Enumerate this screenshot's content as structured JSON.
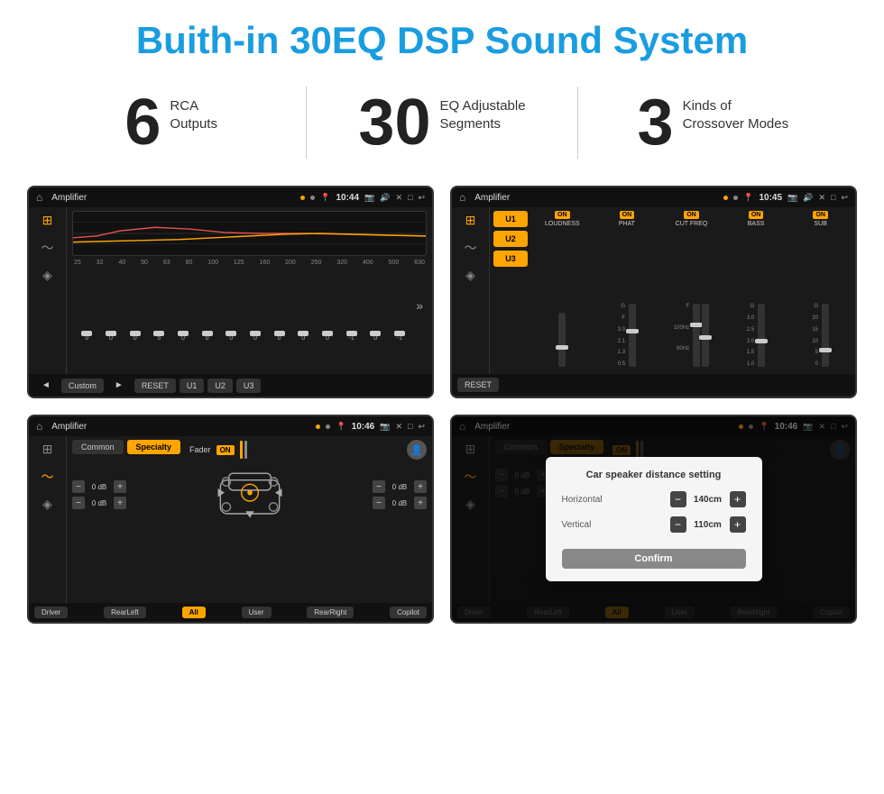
{
  "page": {
    "title": "Buith-in 30EQ DSP Sound System"
  },
  "stats": [
    {
      "number": "6",
      "label": "RCA\nOutputs"
    },
    {
      "number": "30",
      "label": "EQ Adjustable\nSegments"
    },
    {
      "number": "3",
      "label": "Kinds of\nCrossover Modes"
    }
  ],
  "screens": {
    "eq_screen": {
      "status": {
        "title": "Amplifier",
        "time": "10:44",
        "icons": [
          "▶",
          "⊕",
          "📷",
          "🔊",
          "✕",
          "□"
        ]
      },
      "freq_labels": [
        "25",
        "32",
        "40",
        "50",
        "63",
        "80",
        "100",
        "125",
        "160",
        "200",
        "250",
        "320",
        "400",
        "500",
        "630"
      ],
      "slider_values": [
        "0",
        "0",
        "0",
        "5",
        "0",
        "0",
        "0",
        "0",
        "0",
        "0",
        "0",
        "-1",
        "0",
        "-1"
      ],
      "buttons": {
        "play_prev": "◄",
        "custom": "Custom",
        "play_next": "►",
        "reset": "RESET",
        "u1": "U1",
        "u2": "U2",
        "u3": "U3"
      }
    },
    "amp_screen": {
      "status": {
        "title": "Amplifier",
        "time": "10:45"
      },
      "presets": [
        "U1",
        "U2",
        "U3"
      ],
      "channels": [
        {
          "name": "LOUDNESS",
          "on": true
        },
        {
          "name": "PHAT",
          "on": true
        },
        {
          "name": "CUT FREQ",
          "on": true
        },
        {
          "name": "BASS",
          "on": true
        },
        {
          "name": "SUB",
          "on": true
        }
      ],
      "reset_btn": "RESET"
    },
    "crossover_screen": {
      "status": {
        "title": "Amplifier",
        "time": "10:46"
      },
      "tabs": [
        "Common",
        "Specialty"
      ],
      "fader_label": "Fader",
      "fader_on": "ON",
      "db_values": [
        "0 dB",
        "0 dB",
        "0 dB",
        "0 dB"
      ],
      "bottom_buttons": [
        "Driver",
        "RearLeft",
        "All",
        "User",
        "RearRight",
        "Copilot"
      ]
    },
    "dialog_screen": {
      "status": {
        "title": "Amplifier",
        "time": "10:46"
      },
      "tabs": [
        "Common",
        "Specialty"
      ],
      "fader_on": "ON",
      "dialog": {
        "title": "Car speaker distance setting",
        "horizontal_label": "Horizontal",
        "horizontal_value": "140cm",
        "vertical_label": "Vertical",
        "vertical_value": "110cm",
        "confirm_btn": "Confirm"
      },
      "bottom_buttons": [
        "Driver",
        "RearLeft",
        "All",
        "User",
        "RearRight",
        "Copilot"
      ]
    }
  },
  "colors": {
    "accent": "#1a9de0",
    "orange": "#ffa500",
    "dark_bg": "#1a1a1a",
    "darker_bg": "#111"
  }
}
